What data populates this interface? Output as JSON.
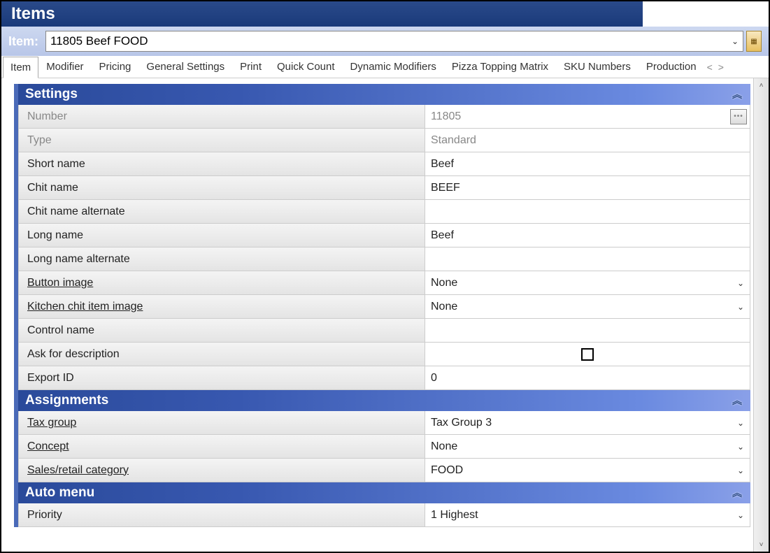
{
  "title": "Items",
  "item_label": "Item:",
  "item_value": "11805 Beef FOOD",
  "tabs": [
    {
      "label": "Item",
      "active": true
    },
    {
      "label": "Modifier"
    },
    {
      "label": "Pricing"
    },
    {
      "label": "General Settings"
    },
    {
      "label": "Print"
    },
    {
      "label": "Quick Count"
    },
    {
      "label": "Dynamic Modifiers"
    },
    {
      "label": "Pizza Topping Matrix"
    },
    {
      "label": "SKU Numbers"
    },
    {
      "label": "Production"
    }
  ],
  "sections": {
    "settings": {
      "title": "Settings",
      "rows": [
        {
          "label": "Number",
          "value": "11805",
          "label_disabled": true,
          "value_disabled": true,
          "dots": true
        },
        {
          "label": "Type",
          "value": "Standard",
          "label_disabled": true,
          "value_disabled": true
        },
        {
          "label": "Short name",
          "value": "Beef"
        },
        {
          "label": "Chit name",
          "value": "BEEF"
        },
        {
          "label": "Chit name alternate",
          "value": ""
        },
        {
          "label": "Long name",
          "value": "Beef"
        },
        {
          "label": "Long name alternate",
          "value": ""
        },
        {
          "label": "Button image",
          "value": "None",
          "underline": true,
          "dropdown": true
        },
        {
          "label": "Kitchen chit item image",
          "value": "None",
          "underline": true,
          "dropdown": true
        },
        {
          "label": "Control name",
          "value": ""
        },
        {
          "label": "Ask for description",
          "checkbox": true
        },
        {
          "label": "Export ID",
          "value": "0"
        }
      ]
    },
    "assignments": {
      "title": "Assignments",
      "rows": [
        {
          "label": "Tax group",
          "value": "Tax Group 3",
          "underline": true,
          "dropdown": true
        },
        {
          "label": "Concept",
          "value": "None",
          "underline": true,
          "dropdown": true
        },
        {
          "label": "Sales/retail category",
          "value": "FOOD",
          "underline": true,
          "dropdown": true
        }
      ]
    },
    "automenu": {
      "title": "Auto menu",
      "rows": [
        {
          "label": "Priority",
          "value": "1 Highest",
          "dropdown": true
        }
      ]
    }
  }
}
